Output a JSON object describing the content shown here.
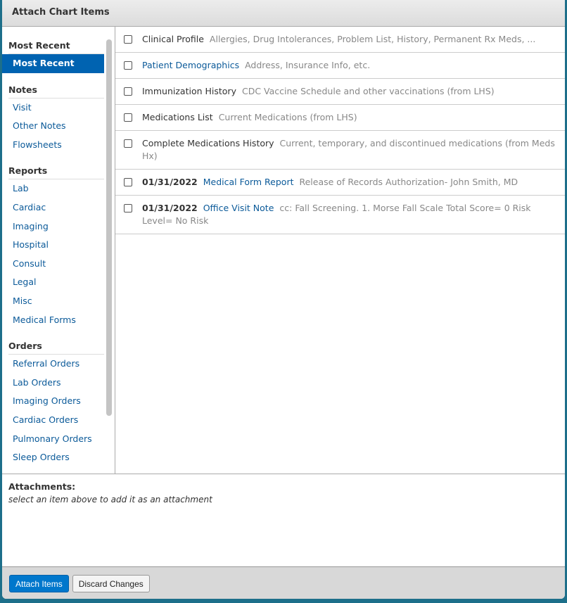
{
  "title": "Attach Chart Items",
  "sidebar": {
    "groups": [
      {
        "heading": "Most Recent",
        "items": [
          "Most Recent"
        ]
      },
      {
        "heading": "Notes",
        "items": [
          "Visit",
          "Other Notes",
          "Flowsheets"
        ]
      },
      {
        "heading": "Reports",
        "items": [
          "Lab",
          "Cardiac",
          "Imaging",
          "Hospital",
          "Consult",
          "Legal",
          "Misc",
          "Medical Forms"
        ]
      },
      {
        "heading": "Orders",
        "items": [
          "Referral Orders",
          "Lab Orders",
          "Imaging Orders",
          "Cardiac Orders",
          "Pulmonary Orders",
          "Sleep Orders"
        ]
      }
    ],
    "selected": "Most Recent"
  },
  "items": [
    {
      "date": "",
      "title": "Clinical Profile",
      "link": false,
      "desc": "Allergies, Drug Intolerances, Problem List, History, Permanent Rx Meds, ..."
    },
    {
      "date": "",
      "title": "Patient Demographics",
      "link": true,
      "desc": "Address, Insurance Info, etc."
    },
    {
      "date": "",
      "title": "Immunization History",
      "link": false,
      "desc": "CDC Vaccine Schedule and other vaccinations (from LHS)"
    },
    {
      "date": "",
      "title": "Medications List",
      "link": false,
      "desc": "Current Medications (from LHS)"
    },
    {
      "date": "",
      "title": "Complete Medications History",
      "link": false,
      "desc": "Current, temporary, and discontinued medications (from Meds Hx)"
    },
    {
      "date": "01/31/2022",
      "title": "Medical Form Report",
      "link": true,
      "desc": "Release of Records Authorization- John Smith, MD"
    },
    {
      "date": "01/31/2022",
      "title": "Office Visit Note",
      "link": true,
      "desc": "cc: Fall Screening. 1. Morse Fall Scale Total Score= 0 Risk Level= No Risk"
    }
  ],
  "attachments": {
    "label": "Attachments:",
    "hint": "select an item above to add it as an attachment"
  },
  "footer": {
    "attach": "Attach Items",
    "discard": "Discard Changes"
  }
}
